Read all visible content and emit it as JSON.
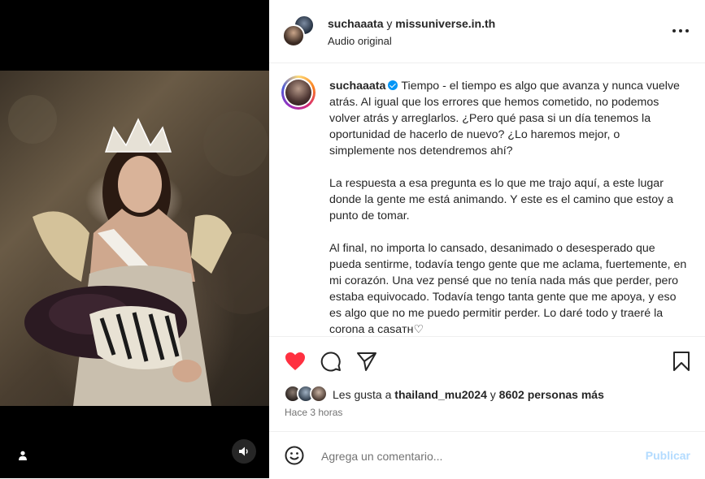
{
  "media": {
    "user_tag_icon": "person-icon",
    "sound_icon": "speaker-icon"
  },
  "header": {
    "author": "suchaaata",
    "connector": " y ",
    "coauthor": "missuniverse.in.th",
    "audio": "Audio original",
    "more_icon": "more-horizontal-icon"
  },
  "caption": {
    "username": "suchaaata",
    "verified": true,
    "paragraphs": [
      "Tiempo - el tiempo es algo que avanza y nunca vuelve atrás. Al igual que los errores que hemos cometido, no podemos volver atrás y arreglarlos. ¿Pero qué pasa si un día tenemos la oportunidad de hacerlo de nuevo? ¿Lo haremos mejor, o simplemente nos detendremos ahí?",
      "La respuesta a esa pregunta es lo que me trajo aquí, a este lugar donde la gente me está animando. Y este es el camino que estoy a punto de tomar.",
      "Al final, no importa lo cansado, desanimado o desesperado que pueda sentirme, todavía tengo gente que me aclama, fuertemente, en mi corazón. Una vez pensé que no tenía nada más que perder, pero estaba equivocado. Todavía tengo tanta gente que me apoya, y eso es algo que no me puedo permitir perder. Lo daré todo y traeré la corona a casaтн♡"
    ]
  },
  "actions": {
    "like_icon": "heart-filled-icon",
    "comment_icon": "comment-bubble-icon",
    "share_icon": "paper-plane-icon",
    "save_icon": "bookmark-icon",
    "like_color": "#ff3040"
  },
  "likes": {
    "prefix": "Les gusta a ",
    "user": "thailand_mu2024",
    "connector": " y ",
    "others": "8602 personas más"
  },
  "time": "Hace 3 horas",
  "comment": {
    "placeholder": "Agrega un comentario...",
    "publish": "Publicar",
    "emoji_icon": "smiley-icon"
  }
}
